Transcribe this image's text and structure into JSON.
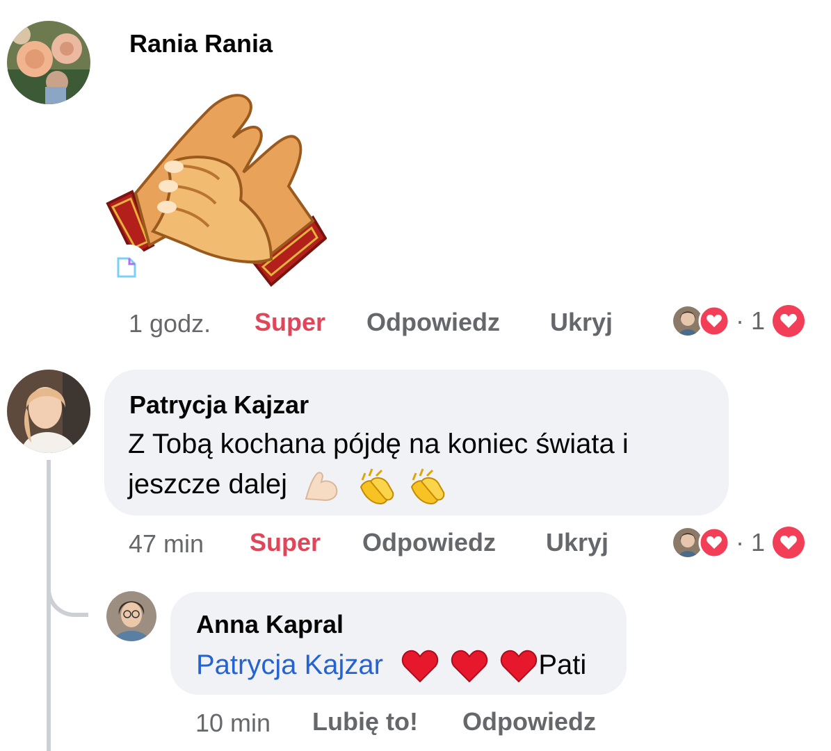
{
  "colors": {
    "accent_super": "#e0455a",
    "mention": "#2463d1",
    "muted": "#65676b",
    "bubble": "#f0f2f5"
  },
  "comment1": {
    "author": "Rania Rania",
    "sticker": "clapping-hands-sticker",
    "time": "1 godz.",
    "reaction_label": "Super",
    "reply_label": "Odpowiedz",
    "hide_label": "Ukryj",
    "reaction_count": "· 1"
  },
  "comment2": {
    "author": "Patrycja Kajzar",
    "text_line1": "Z Tobą kochana pójdę na koniec świata i",
    "text_line2": "jeszcze dalej",
    "emojis": [
      "flexed-biceps-emoji",
      "clapping-hands-emoji",
      "clapping-hands-emoji"
    ],
    "time": "47 min",
    "reaction_label": "Super",
    "reply_label": "Odpowiedz",
    "hide_label": "Ukryj",
    "reaction_count": "· 1"
  },
  "reply1": {
    "author": "Anna Kapral",
    "mention": "Patrycja Kajzar",
    "emojis": [
      "red-heart-emoji",
      "red-heart-emoji",
      "red-heart-emoji"
    ],
    "text_tail": "Pati",
    "time": "10 min",
    "like_label": "Lubię to!",
    "reply_label": "Odpowiedz"
  }
}
